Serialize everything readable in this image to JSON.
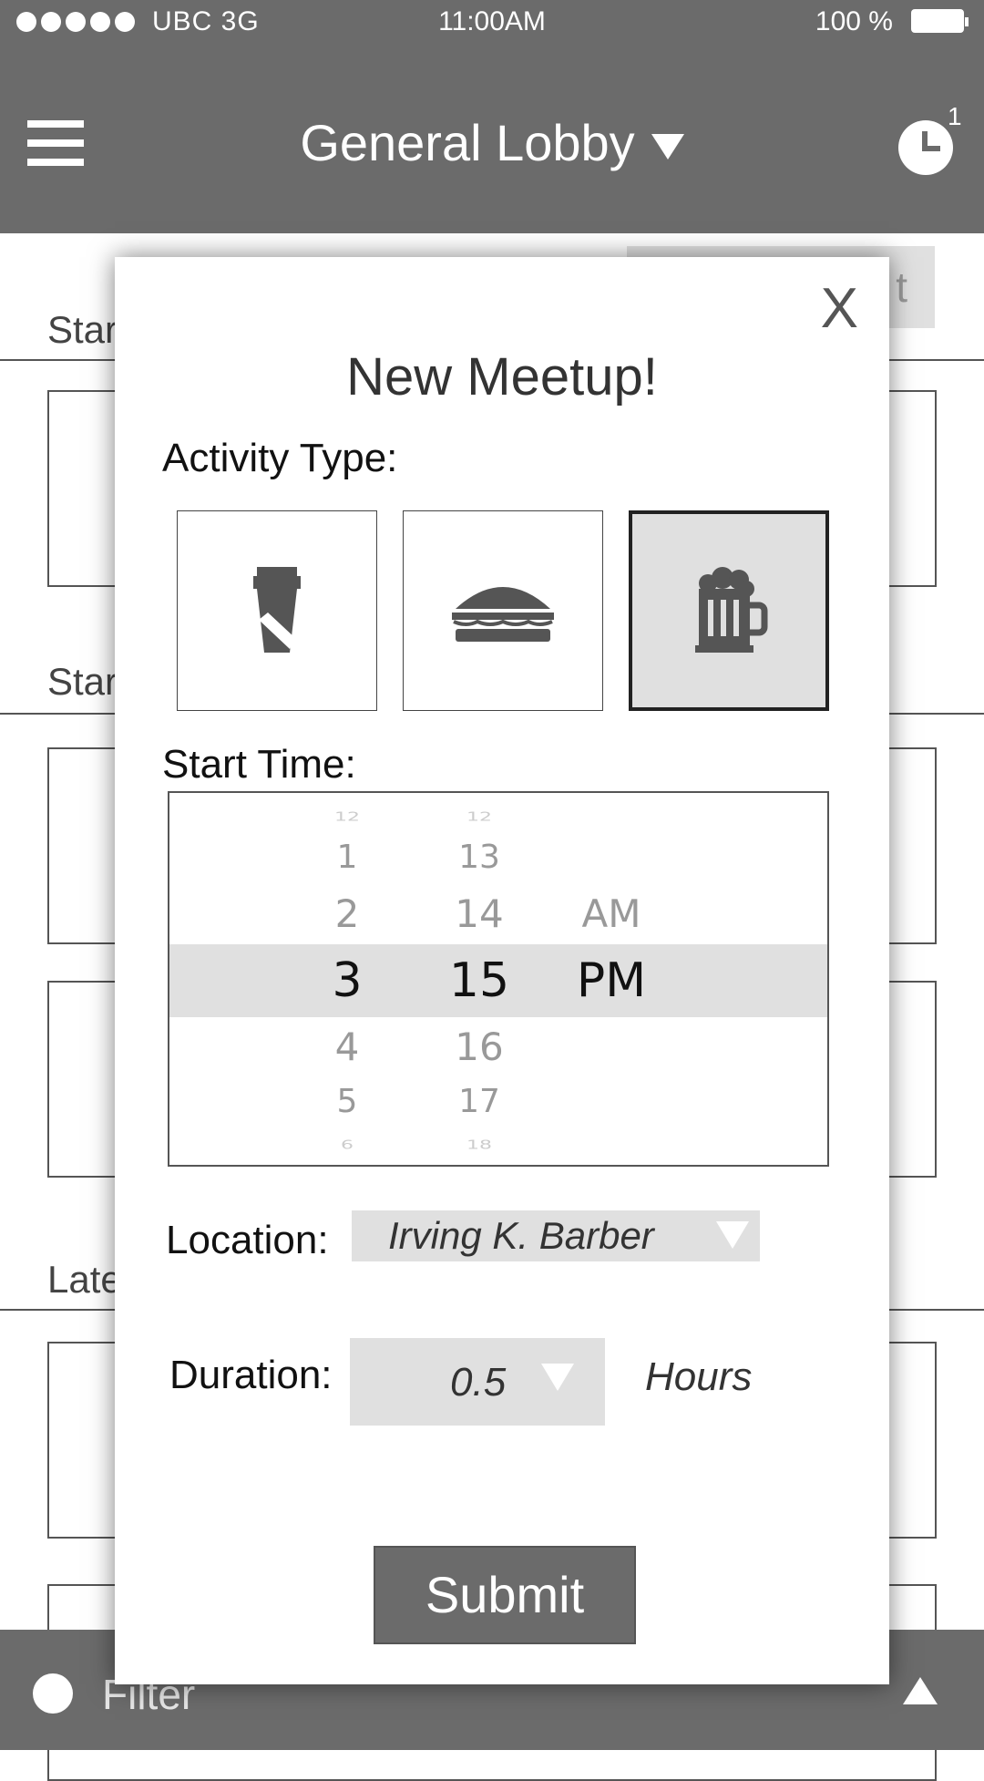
{
  "status_bar": {
    "carrier": "UBC  3G",
    "time": "11:00AM",
    "battery": "100 %"
  },
  "header": {
    "title": "General Lobby",
    "notification_count": "1"
  },
  "background": {
    "sections": [
      "Star",
      "Star",
      "Late"
    ],
    "create_button": "t"
  },
  "modal": {
    "close_label": "X",
    "title": "New Meetup!",
    "activity_label": "Activity Type:",
    "activities": [
      {
        "name": "coffee-icon",
        "selected": false
      },
      {
        "name": "burger-icon",
        "selected": false
      },
      {
        "name": "beer-icon",
        "selected": true
      }
    ],
    "start_time_label": "Start Time:",
    "picker": {
      "hours": [
        "12",
        "1",
        "2",
        "3",
        "4",
        "5",
        "6"
      ],
      "minutes": [
        "12",
        "13",
        "14",
        "15",
        "16",
        "17",
        "18"
      ],
      "ampm": [
        "AM",
        "PM"
      ],
      "selected": {
        "hour": "3",
        "minute": "15",
        "ampm": "PM"
      }
    },
    "location_label": "Location:",
    "location_value": "Irving K. Barber",
    "duration_label": "Duration:",
    "duration_value": "0.5",
    "duration_unit": "Hours",
    "submit_label": "Submit"
  },
  "bottom_bar": {
    "filter_label": "Filter"
  },
  "colors": {
    "header": "#6b6b6b",
    "selected_tile": "#e0e0e0",
    "submit": "#6b6b6b"
  }
}
